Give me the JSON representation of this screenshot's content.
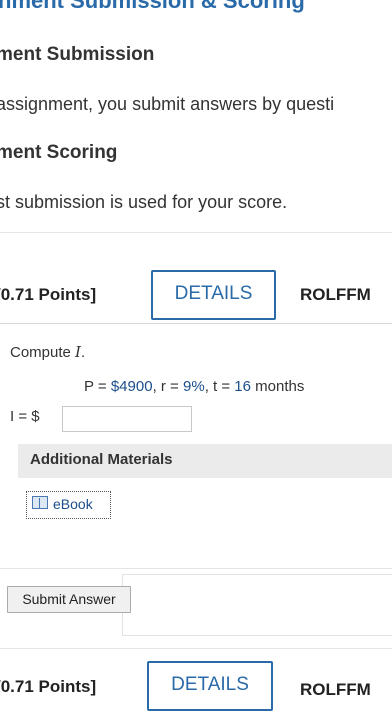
{
  "header": {
    "partial_title": "nment Submission & Scoring"
  },
  "sections": [
    {
      "heading": "ment Submission",
      "text": "assignment, you submit answers by questi"
    },
    {
      "heading": "ment Scoring",
      "text": "st submission is used for your score."
    }
  ],
  "question1": {
    "points": "/0.71 Points]",
    "details_label": "DETAILS",
    "code_label": "ROLFFM",
    "compute_prefix": "Compute ",
    "compute_var": "I",
    "compute_suffix": ".",
    "formula": {
      "p_label": "P = ",
      "p_value": "$4900",
      "r_label": ", r = ",
      "r_value": "9%",
      "t_label": ", t = ",
      "t_value": "16",
      "t_unit": " months"
    },
    "answer_label": "I = $",
    "answer_value": "",
    "additional_materials": "Additional Materials",
    "ebook_label": "eBook",
    "submit_label": "Submit Answer"
  },
  "question2": {
    "points": "/0.71 Points]",
    "details_label": "DETAILS",
    "code_label": "ROLFFM"
  },
  "colors": {
    "accent": "#2a6aa8",
    "value": "#1c4f8c"
  }
}
